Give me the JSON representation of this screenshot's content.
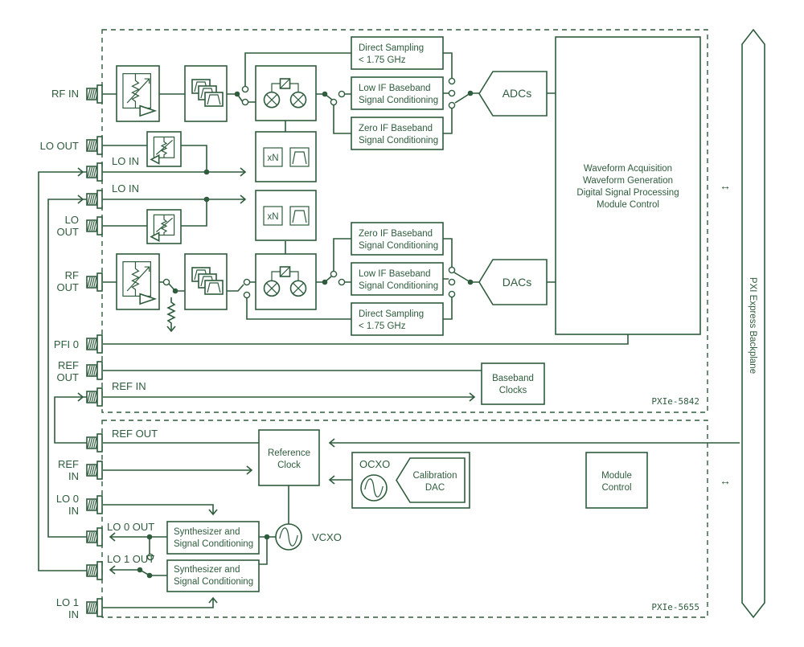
{
  "colors": {
    "line": "#2e5c3c",
    "background": "#ffffff"
  },
  "modules": {
    "top": "PXIe-5842",
    "bottom": "PXIe-5655"
  },
  "backplane": {
    "label": "PXI Express Backplane"
  },
  "bidirectional_arrow": "↔",
  "ports": {
    "rf_in": [
      "RF IN"
    ],
    "lo_out_1": [
      "LO OUT"
    ],
    "lo_in_1": "LO IN",
    "lo_in_2": "LO IN",
    "lo_out_2": [
      "LO",
      "OUT"
    ],
    "rf_out": [
      "RF",
      "OUT"
    ],
    "pfi0": [
      "PFI 0"
    ],
    "ref_out_1": [
      "REF",
      "OUT"
    ],
    "ref_in_1": "REF IN",
    "ref_out_2": "REF OUT",
    "ref_in_2": [
      "REF",
      "IN"
    ],
    "lo0_in": [
      "LO 0",
      "IN"
    ],
    "lo0_out": "LO 0 OUT",
    "lo1_out": "LO 1 OUT",
    "lo1_in": [
      "LO 1",
      "IN"
    ]
  },
  "blocks": {
    "direct_sampling_rx": [
      "Direct Sampling",
      "< 1.75 GHz"
    ],
    "low_if_rx": [
      "Low IF Baseband",
      "Signal Conditioning"
    ],
    "zero_if_rx": [
      "Zero IF Baseband",
      "Signal Conditioning"
    ],
    "zero_if_tx": [
      "Zero IF Baseband",
      "Signal Conditioning"
    ],
    "low_if_tx": [
      "Low IF Baseband",
      "Signal Conditioning"
    ],
    "direct_sampling_tx": [
      "Direct Sampling",
      "< 1.75 GHz"
    ],
    "adcs": "ADCs",
    "dacs": "DACs",
    "fpga": [
      "Waveform Acquisition",
      "Waveform Generation",
      "Digital Signal Processing",
      "Module Control"
    ],
    "multiplier": "xN",
    "baseband_clocks": [
      "Baseband",
      "Clocks"
    ],
    "reference_clock": [
      "Reference",
      "Clock"
    ],
    "ocxo": "OCXO",
    "calibration_dac": [
      "Calibration",
      "DAC"
    ],
    "module_control": [
      "Module",
      "Control"
    ],
    "vcxo": "VCXO",
    "synth0": [
      "Synthesizer and",
      "Signal Conditioning"
    ],
    "synth1": [
      "Synthesizer and",
      "Signal Conditioning"
    ]
  }
}
